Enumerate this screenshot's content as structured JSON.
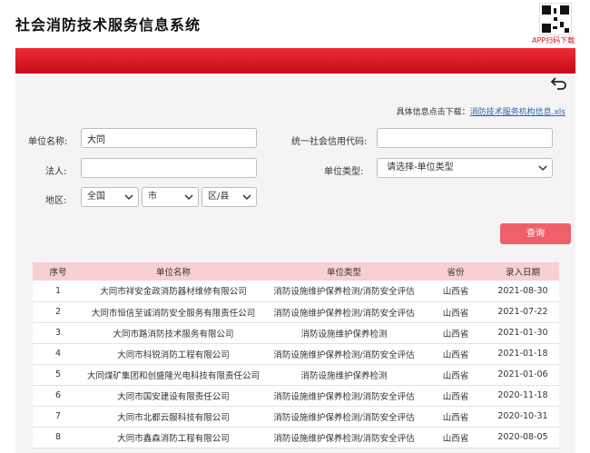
{
  "header": {
    "title": "社会消防技术服务信息系统",
    "app_download": "APP扫码下载",
    "brand_color": "#d7141f"
  },
  "download": {
    "prefix": "具体信息点击下载：",
    "link": "消防技术服务机构信息.xls"
  },
  "form": {
    "name_label": "单位名称:",
    "name_value": "大同",
    "credit_label": "统一社会信用代码:",
    "credit_value": "",
    "legal_label": "法人:",
    "legal_value": "",
    "type_label": "单位类型:",
    "type_value": "请选择-单位类型",
    "region_label": "地区:",
    "country_value": "全国",
    "city_value": "市",
    "district_value": "区/县",
    "query_button": "查询"
  },
  "table": {
    "headers": [
      "序号",
      "单位名称",
      "单位类型",
      "省份",
      "录入日期"
    ],
    "rows": [
      [
        "1",
        "大同市祥安金政消防器材维修有限公司",
        "消防设施维护保养检测/消防安全评估",
        "山西省",
        "2021-08-30"
      ],
      [
        "2",
        "大同市恒信至诚消防安全服务有限责任公司",
        "消防设施维护保养检测/消防安全评估",
        "山西省",
        "2021-07-22"
      ],
      [
        "3",
        "大同市路消防技术服务有限公司",
        "消防设施维护保养检测",
        "山西省",
        "2021-01-30"
      ],
      [
        "4",
        "大同市科锐消防工程有限公司",
        "消防设施维护保养检测/消防安全评估",
        "山西省",
        "2021-01-18"
      ],
      [
        "5",
        "大同煤矿集团和创盛隆光电科技有限责任公司",
        "消防设施维护保养检测",
        "山西省",
        "2021-01-06"
      ],
      [
        "6",
        "大同市国安建设有限责任公司",
        "消防设施维护保养检测/消防安全评估",
        "山西省",
        "2020-11-18"
      ],
      [
        "7",
        "大同市北都云服科技有限公司",
        "消防设施维护保养检测/消防安全评估",
        "山西省",
        "2020-10-31"
      ],
      [
        "8",
        "大同市鑫森消防工程有限公司",
        "消防设施维护保养检测/消防安全评估",
        "山西省",
        "2020-08-05"
      ]
    ]
  }
}
